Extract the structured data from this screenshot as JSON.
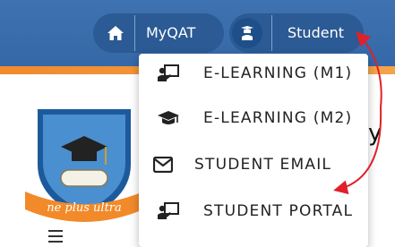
{
  "nav": {
    "home_icon": "home-icon",
    "myqat_label": "MyQAT",
    "student_icon": "student-graduate-icon",
    "student_label": "Student"
  },
  "dropdown": {
    "items": [
      {
        "label": "E-LEARNING (M1)",
        "icon": "chalkboard-teacher-icon"
      },
      {
        "label": "E-LEARNING (M2)",
        "icon": "graduation-cap-icon"
      },
      {
        "label": "STUDENT EMAIL",
        "icon": "envelope-icon"
      },
      {
        "label": "STUDENT PORTAL",
        "icon": "chalkboard-teacher-icon"
      }
    ]
  },
  "logo": {
    "motto": "ne plus ultra"
  },
  "side_text": "y",
  "colors": {
    "header_blue": "#3468a7",
    "header_pill": "#2b5a94",
    "orange_stripe": "#f08a2c",
    "annotation_red": "#e0202a"
  }
}
